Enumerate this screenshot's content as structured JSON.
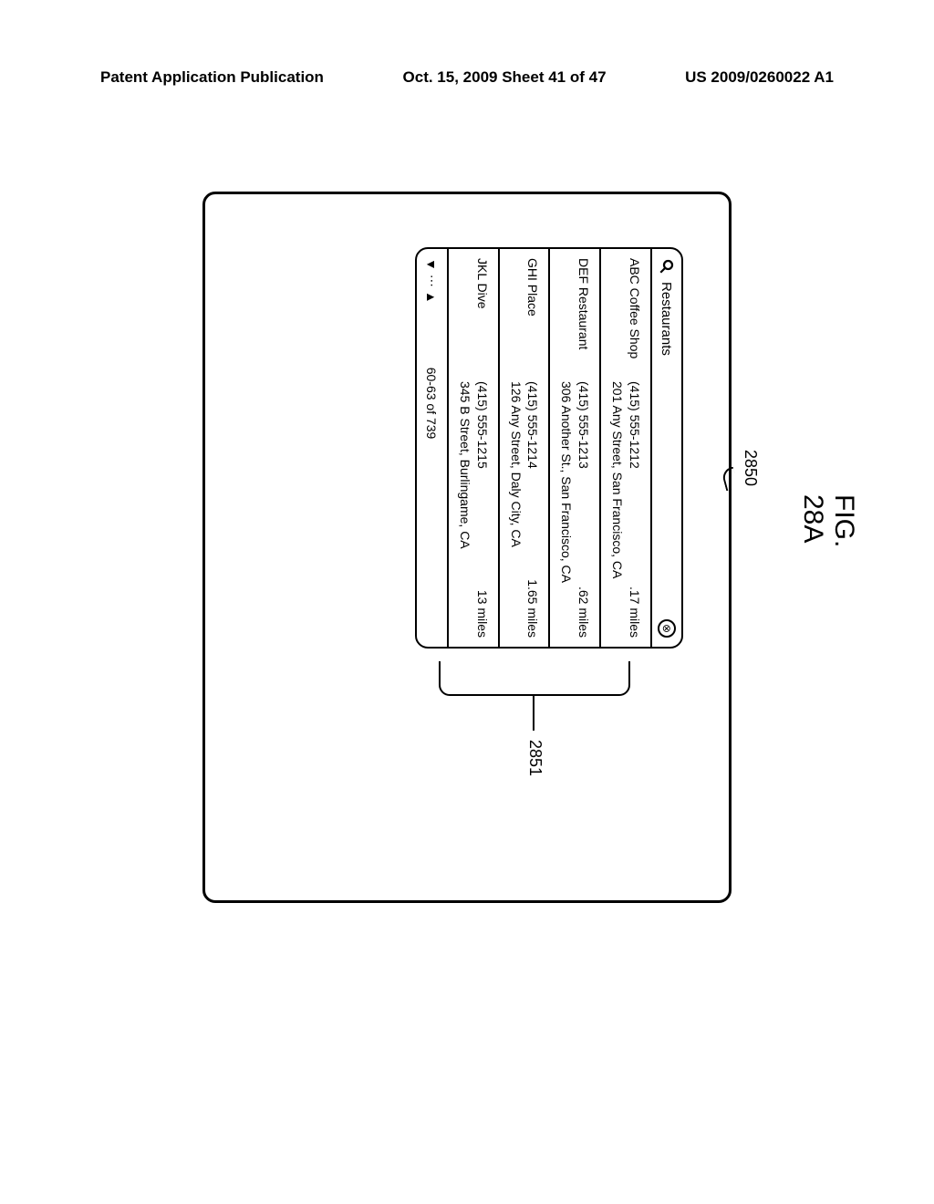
{
  "header": {
    "left": "Patent Application Publication",
    "center": "Oct. 15, 2009  Sheet 41 of 47",
    "right": "US 2009/0260022 A1"
  },
  "refs": {
    "r2850": "2850",
    "r2851": "2851"
  },
  "search": {
    "value": "Restaurants",
    "clear_glyph": "⊗"
  },
  "results": [
    {
      "name": "ABC Coffee Shop",
      "phone": "(415) 555-1212",
      "address": "201 Any Street, San Francisco, CA",
      "distance": ".17 miles"
    },
    {
      "name": "DEF Restaurant",
      "phone": "(415) 555-1213",
      "address": "306 Another St., San Francisco, CA",
      "distance": ".62 miles"
    },
    {
      "name": "GHI Place",
      "phone": "(415) 555-1214",
      "address": "126 Any Street, Daly City, CA",
      "distance": "1.65 miles"
    },
    {
      "name": "JKL Dive",
      "phone": "(415) 555-1215",
      "address": "345 B Street, Burlingame, CA",
      "distance": "13 miles"
    }
  ],
  "footer": {
    "down_glyph": "▼",
    "dots": "⋯",
    "up_glyph": "▲",
    "range": "60-63 of 739"
  },
  "figure_label": "FIG. 28A"
}
